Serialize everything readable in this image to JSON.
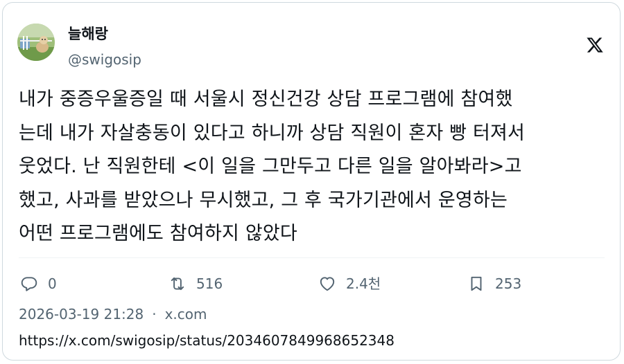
{
  "author": {
    "display_name": "늘해랑",
    "handle": "@swigosip",
    "avatar": "avatar-photo-dog"
  },
  "platform_logo": "x-logo-icon",
  "tweet": {
    "text": "내가 중증우울증일 때 서울시 정신건강 상담 프로그램에 참여했\n는데 내가 자살충동이 있다고 하니까 상담 직원이 혼자 빵 터져서\n웃었다. 난 직원한테 <이 일을 그만두고 다른 일을 알아봐라>고\n했고, 사과를 받았으나 무시했고, 그 후 국가기관에서 운영하는\n어떤 프로그램에도 참여하지 않았다"
  },
  "actions": {
    "reply": {
      "icon": "reply-icon",
      "count": "0"
    },
    "retweet": {
      "icon": "retweet-icon",
      "count": "516"
    },
    "like": {
      "icon": "heart-icon",
      "count": "2.4천"
    },
    "bookmark": {
      "icon": "bookmark-icon",
      "count": "253"
    }
  },
  "meta": {
    "timestamp": "2026-03-19 21:28",
    "separator": "·",
    "source": "x.com"
  },
  "url": "https://x.com/swigosip/status/2034607849968652348",
  "colors": {
    "text_primary": "#0f1419",
    "text_secondary": "#536471",
    "border": "#cfd9de"
  }
}
